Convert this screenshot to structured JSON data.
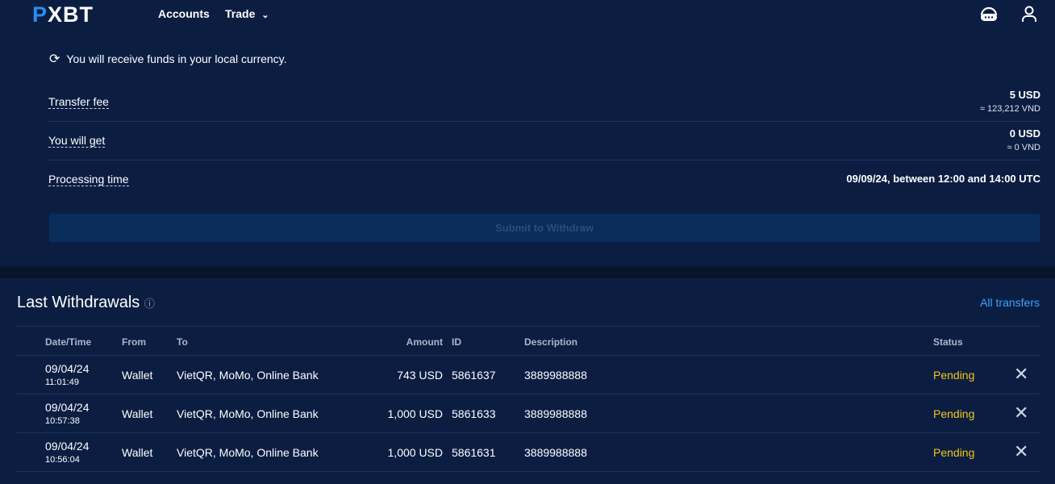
{
  "nav": {
    "logo": "PXBT",
    "logo_accent": "P",
    "logo_rest": "XBT",
    "accounts": "Accounts",
    "trade": "Trade"
  },
  "info": "You will receive funds in your local currency.",
  "summary": [
    {
      "label": "Transfer fee",
      "value": "5 USD",
      "sub": "≈ 123,212 VND"
    },
    {
      "label": "You will get",
      "value": "0 USD",
      "sub": "≈ 0 VND"
    },
    {
      "label": "Processing time",
      "value": "09/09/24, between 12:00 and 14:00 UTC",
      "sub": ""
    }
  ],
  "submit_label": "Submit to Withdraw",
  "withdrawals": {
    "title": "Last Withdrawals",
    "all_transfers": "All transfers",
    "headers": {
      "date": "Date/Time",
      "from": "From",
      "to": "To",
      "amount": "Amount",
      "id": "ID",
      "desc": "Description",
      "status": "Status"
    },
    "rows": [
      {
        "date": "09/04/24",
        "time": "11:01:49",
        "from": "Wallet",
        "to": "VietQR, MoMo, Online Bank",
        "amount": "743 USD",
        "id": "5861637",
        "desc": "3889988888",
        "status": "Pending"
      },
      {
        "date": "09/04/24",
        "time": "10:57:38",
        "from": "Wallet",
        "to": "VietQR, MoMo, Online Bank",
        "amount": "1,000 USD",
        "id": "5861633",
        "desc": "3889988888",
        "status": "Pending"
      },
      {
        "date": "09/04/24",
        "time": "10:56:04",
        "from": "Wallet",
        "to": "VietQR, MoMo, Online Bank",
        "amount": "1,000 USD",
        "id": "5861631",
        "desc": "3889988888",
        "status": "Pending"
      }
    ]
  },
  "colors": {
    "bg": "#0b1e42",
    "accent": "#2d8cf0",
    "pending": "#f5c518",
    "link": "#3ea0ff"
  }
}
